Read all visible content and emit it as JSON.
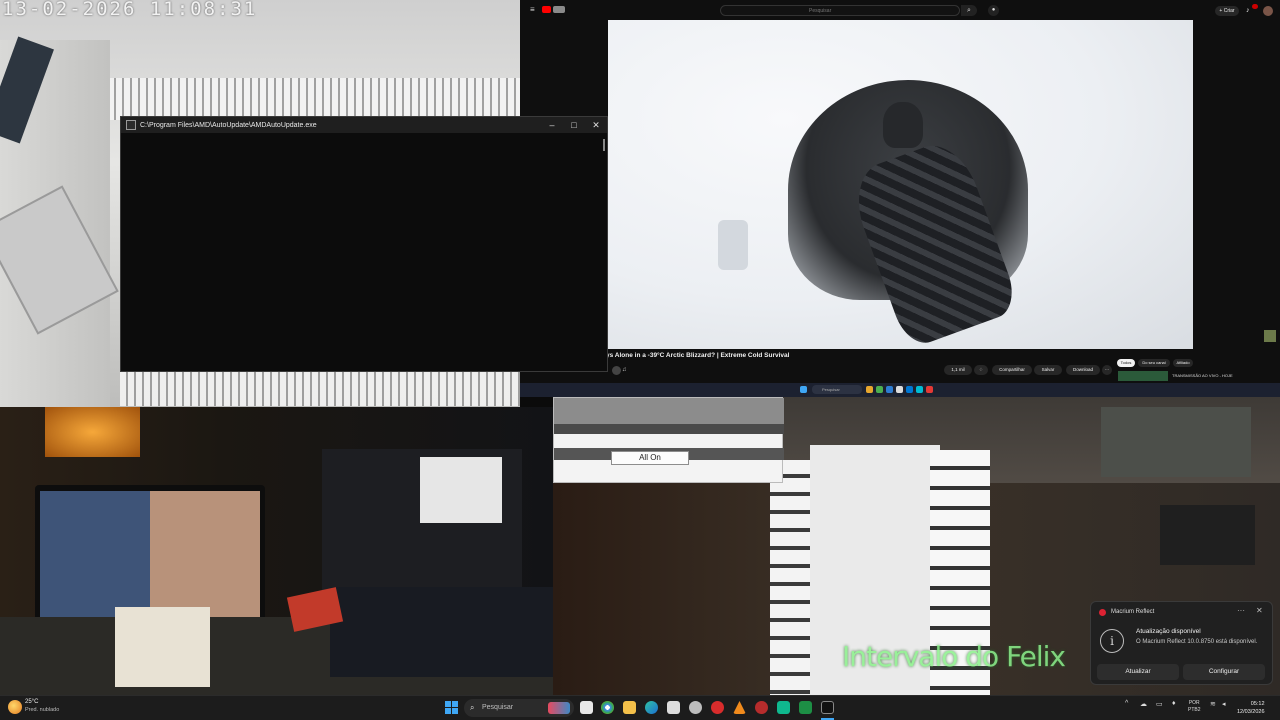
{
  "camera_top_left": {
    "timestamp": "13-02-2026  11:08:31"
  },
  "console_window": {
    "title": "C:\\Program Files\\AMD\\AutoUpdate\\AMDAutoUpdate.exe",
    "minimize": "–",
    "maximize": "□",
    "close": "✕"
  },
  "youtube": {
    "search_placeholder": "Pesquisar",
    "create_label": "+ Criar",
    "video_title": "ys Alone in a -39°C Arctic Blizzard? | Extreme Cold Survival",
    "actions": {
      "like_count": "1,1 mil",
      "share": "Compartilhar",
      "save": "Salvar",
      "download": "Download",
      "more": "···"
    },
    "chips": [
      "Todos",
      "Do seu canal",
      "Afiliado"
    ],
    "sidebar_item": "TRANSMISSÃO AO VIVO - HOJE"
  },
  "allon_window": {
    "button_label": "All On"
  },
  "overlay_text": "Intervalo do Felix",
  "toast": {
    "app_name": "Macrium Reflect",
    "heading": "Atualização disponível",
    "body": "O Macrium Reflect 10.0.8750 está disponível.",
    "btn_update": "Atualizar",
    "btn_configure": "Configurar",
    "menu": "···",
    "close": "✕"
  },
  "taskbar": {
    "weather_temp": "25°C",
    "weather_desc": "Pred. nublado",
    "search_placeholder": "Pesquisar",
    "lang_line1": "POR",
    "lang_line2": "PTB2",
    "time": "05:12",
    "date": "12/03/2026",
    "tray_chevron": "^"
  },
  "colors": {
    "youtube_red": "#ff0000",
    "taskbar_bg": "#1c1c1c",
    "toast_bg": "#202020",
    "console_bg": "#0c0c0c",
    "windows_blue": "#3fa7f5"
  },
  "icons": {
    "start": "windows-start-icon",
    "search": "search-icon",
    "info": "info-icon",
    "weather": "sun-cloud-icon"
  }
}
